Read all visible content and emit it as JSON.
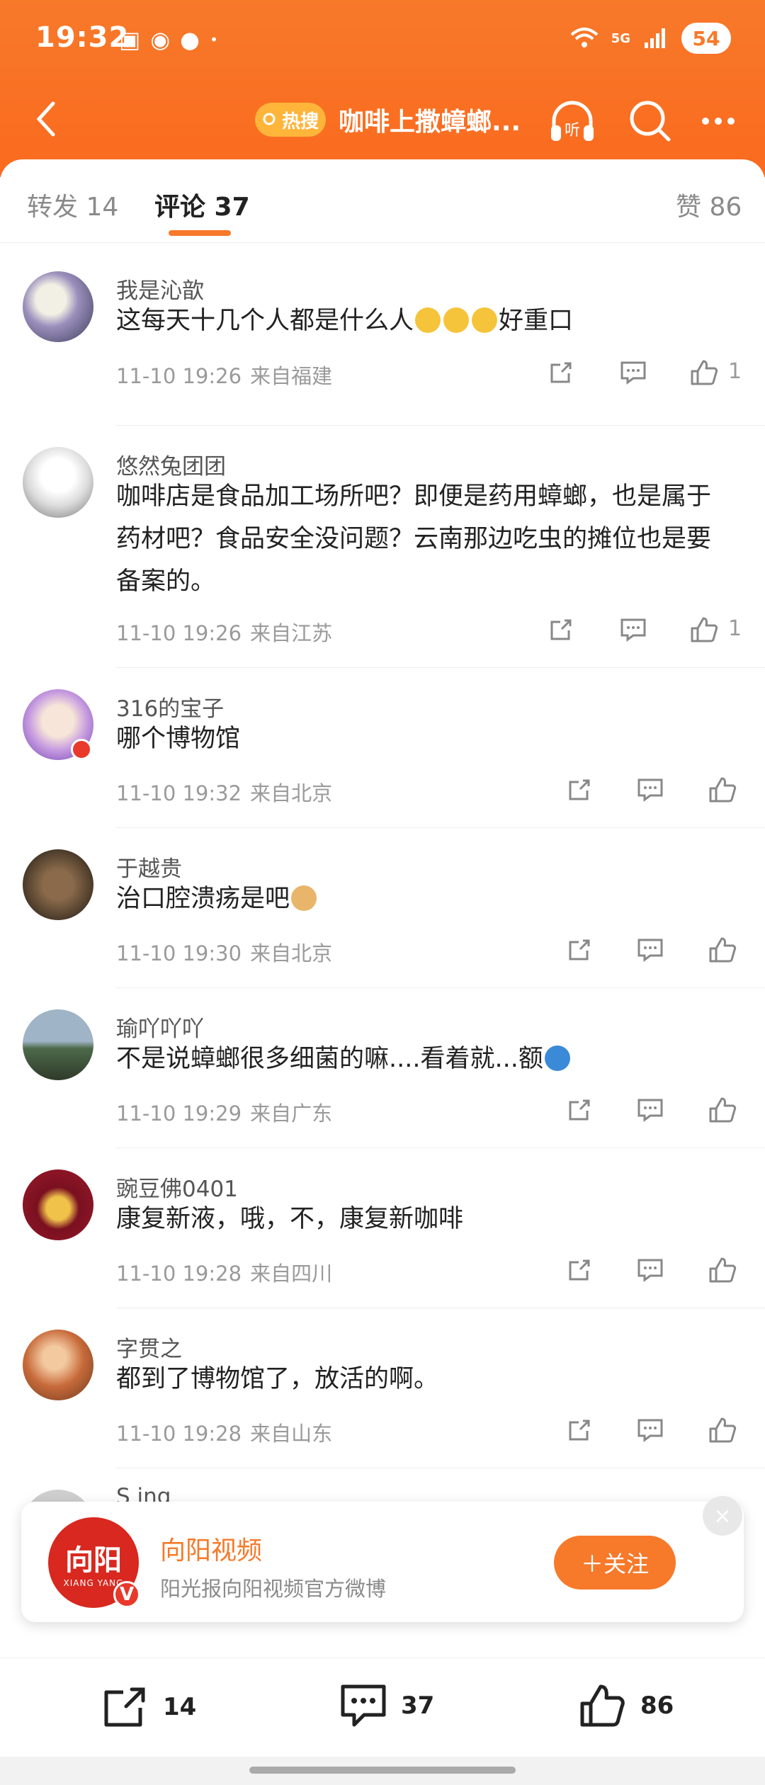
{
  "status": {
    "time": "19:32",
    "signal": "5G",
    "battery": "54"
  },
  "nav": {
    "hot_label": "热搜",
    "title": "咖啡上撒蟑螂...",
    "listen_label": "听"
  },
  "tabs": [
    {
      "label": "转发 14"
    },
    {
      "label": "评论 37"
    },
    {
      "label": "赞 86"
    }
  ],
  "comments": [
    {
      "name": "我是沁歆",
      "text_before": "这每天十几个人都是什么人",
      "text_after": "好重口",
      "time": "11-10 19:26",
      "loc": "来自福建",
      "likes": "1"
    },
    {
      "name": "悠然兔团团",
      "text": "咖啡店是食品加工场所吧？即便是药用蟑螂，也是属于药材吧？食品安全没问题？云南那边吃虫的摊位也是要备案的。",
      "time": "11-10 19:26",
      "loc": "来自江苏",
      "likes": "1"
    },
    {
      "name": "316的宝子",
      "text": "哪个博物馆",
      "time": "11-10 19:32",
      "loc": "来自北京",
      "likes": ""
    },
    {
      "name": "于越贵",
      "text": "治口腔溃疡是吧",
      "time": "11-10 19:30",
      "loc": "来自北京",
      "likes": ""
    },
    {
      "name": "瑜吖吖吖",
      "text": "不是说蟑螂很多细菌的嘛....看着就...额",
      "time": "11-10 19:29",
      "loc": "来自广东",
      "likes": ""
    },
    {
      "name": "豌豆佛0401",
      "text": "康复新液，哦，不，康复新咖啡",
      "time": "11-10 19:28",
      "loc": "来自四川",
      "likes": ""
    },
    {
      "name": "字贯之",
      "text": "都到了博物馆了，放活的啊。",
      "time": "11-10 19:28",
      "loc": "来自山东",
      "likes": ""
    },
    {
      "name": "S ing",
      "text": "",
      "time": "",
      "loc": "",
      "likes": ""
    }
  ],
  "follow_card": {
    "logo_text": "向阳",
    "logo_sub": "XIANG YANG",
    "name": "向阳视频",
    "desc": "阳光报向阳视频官方微博",
    "button": "＋关注",
    "close": "×"
  },
  "bottom_bar": {
    "repost_count": "14",
    "comment_count": "37",
    "like_count": "86"
  },
  "colors": {
    "accent": "#f7792a",
    "verified": "#e8392b"
  }
}
